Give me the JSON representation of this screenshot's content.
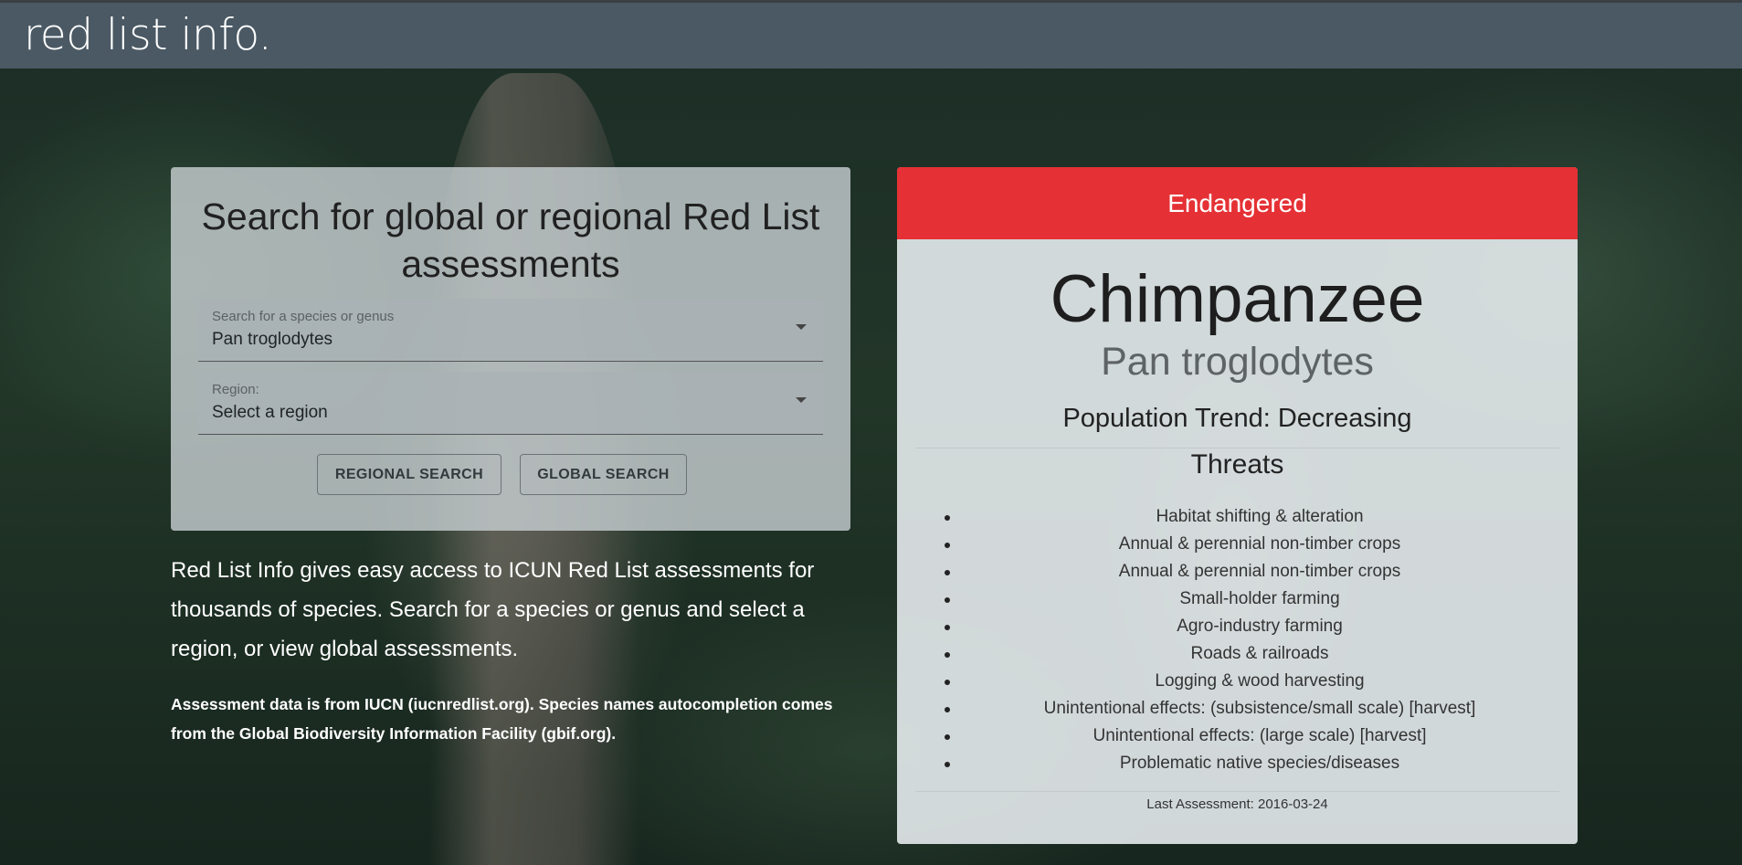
{
  "app": {
    "brand": "red list info."
  },
  "search": {
    "title": "Search for global or regional Red List assessments",
    "species_field": {
      "label": "Search for a species or genus",
      "value": "Pan troglodytes"
    },
    "region_field": {
      "label": "Region:",
      "value": "Select a region"
    },
    "regional_button": "REGIONAL SEARCH",
    "global_button": "GLOBAL SEARCH"
  },
  "intro": {
    "text": "Red List Info gives easy access to ICUN Red List assessments for thousands of species. Search for a species or genus and select a region, or view global assessments.",
    "credit": "Assessment data is from IUCN (iucnredlist.org). Species names autocompletion comes from the Global Biodiversity Information Facility (gbif.org)."
  },
  "result": {
    "status": "Endangered",
    "status_color": "#e53135",
    "common_name": "Chimpanzee",
    "scientific_name": "Pan troglodytes",
    "population_trend": "Population Trend: Decreasing",
    "threats_title": "Threats",
    "threats": [
      "Habitat shifting & alteration",
      "Annual & perennial non-timber crops",
      "Annual & perennial non-timber crops",
      "Small-holder farming",
      "Agro-industry farming",
      "Roads & railroads",
      "Logging & wood harvesting",
      "Unintentional effects: (subsistence/small scale) [harvest]",
      "Unintentional effects: (large scale) [harvest]",
      "Problematic native species/diseases"
    ],
    "last_assessment": "Last Assessment: 2016-03-24"
  }
}
